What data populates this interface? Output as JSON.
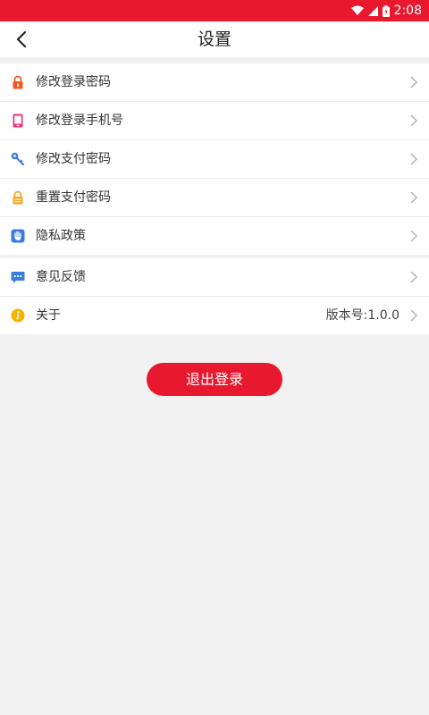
{
  "status_bar": {
    "time": "2:08"
  },
  "header": {
    "title": "设置"
  },
  "groups": [
    {
      "items": [
        {
          "label": "修改登录密码",
          "icon": "lock-icon",
          "color": "#f15a22"
        },
        {
          "label": "修改登录手机号",
          "icon": "phone-icon",
          "color": "#e8337a"
        },
        {
          "label": "修改支付密码",
          "icon": "key-icon",
          "color": "#3a7de0"
        },
        {
          "label": "重置支付密码",
          "icon": "padlock-icon",
          "color": "#f5a623"
        },
        {
          "label": "隐私政策",
          "icon": "hand-icon",
          "color": "#3a7de0"
        }
      ]
    },
    {
      "items": [
        {
          "label": "意见反馈",
          "icon": "feedback-icon",
          "color": "#3a7de0"
        },
        {
          "label": "关于",
          "icon": "info-icon",
          "color": "#f5b400",
          "value": "版本号:1.0.0"
        }
      ]
    }
  ],
  "logout_label": "退出登录",
  "colors": {
    "brand": "#e8182e",
    "background": "#f2f2f2"
  }
}
